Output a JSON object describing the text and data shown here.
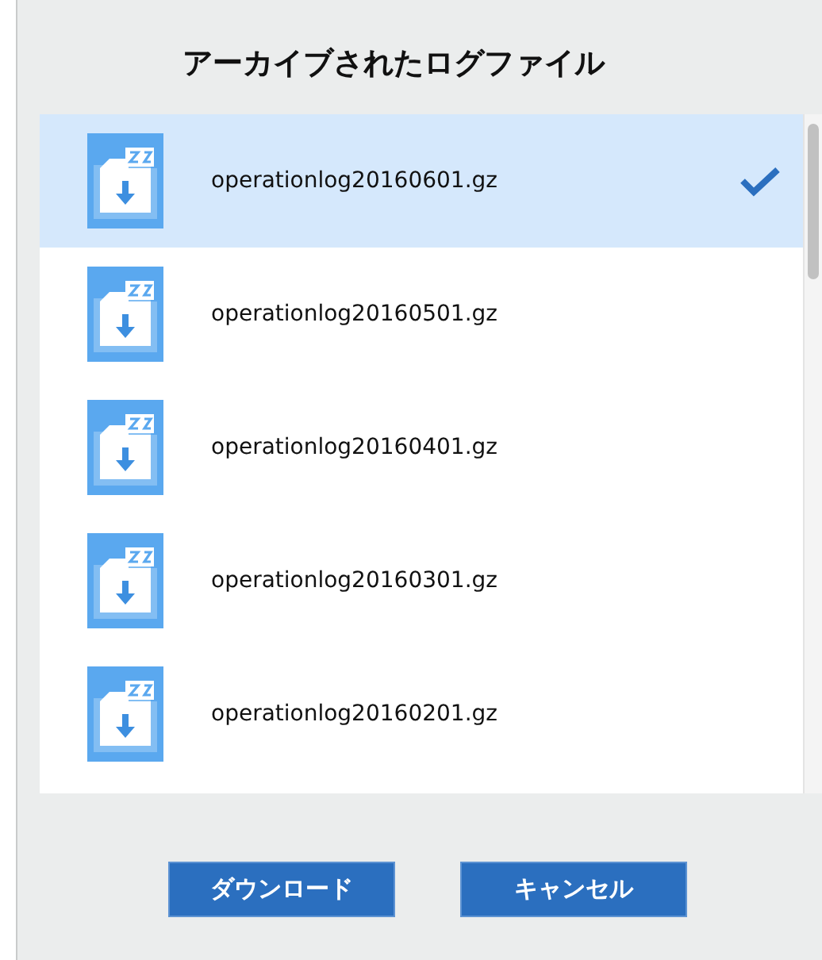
{
  "title": "アーカイブされたログファイル",
  "files": [
    {
      "name": "operationlog20160601.gz",
      "selected": true
    },
    {
      "name": "operationlog20160501.gz",
      "selected": false
    },
    {
      "name": "operationlog20160401.gz",
      "selected": false
    },
    {
      "name": "operationlog20160301.gz",
      "selected": false
    },
    {
      "name": "operationlog20160201.gz",
      "selected": false
    }
  ],
  "buttons": [
    "ダウンロード",
    "キャンセル"
  ]
}
